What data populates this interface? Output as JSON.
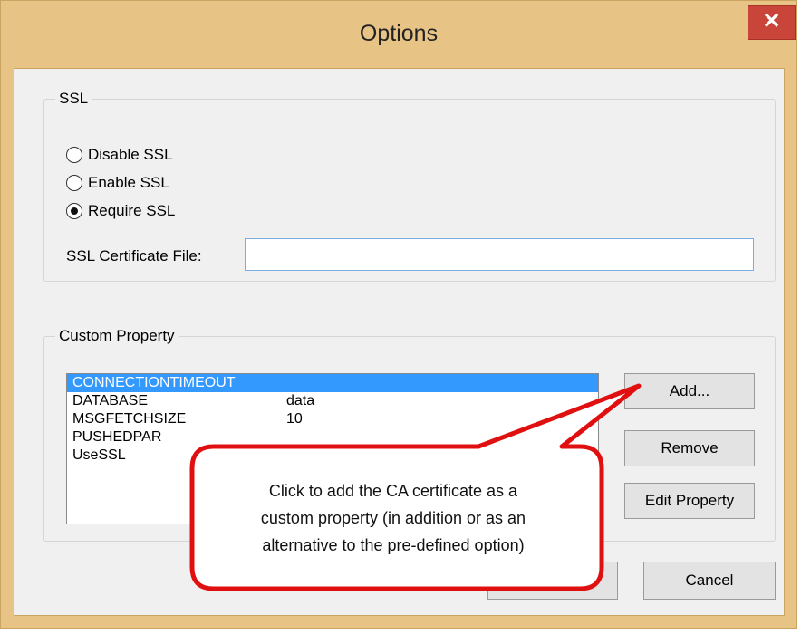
{
  "window": {
    "title": "Options",
    "close_glyph": "✕"
  },
  "ssl": {
    "group_title": "SSL",
    "options": [
      {
        "label": "Disable SSL",
        "checked": false
      },
      {
        "label": "Enable SSL",
        "checked": false
      },
      {
        "label": "Require SSL",
        "checked": true
      }
    ],
    "certificate_label": "SSL Certificate File:",
    "certificate_value": ""
  },
  "custom_property": {
    "group_title": "Custom Property",
    "items": [
      {
        "name": "CONNECTIONTIMEOUT",
        "value": "",
        "selected": true
      },
      {
        "name": "DATABASE",
        "value": "data",
        "selected": false
      },
      {
        "name": "MSGFETCHSIZE",
        "value": "10",
        "selected": false
      },
      {
        "name": "PUSHEDPAR",
        "value": "",
        "selected": false
      },
      {
        "name": "UseSSL",
        "value": "",
        "selected": false
      }
    ],
    "add_label": "Add...",
    "remove_label": "Remove",
    "edit_label": "Edit Property"
  },
  "footer": {
    "cancel_label": "Cancel"
  },
  "callout": {
    "line1": "Click to add the CA certificate as a",
    "line2": "custom property (in addition or as an",
    "line3": "alternative to the pre-defined option)"
  },
  "colors": {
    "frame": "#e8c386",
    "close": "#c9453a",
    "selection": "#3399ff",
    "callout_border": "#e01010"
  },
  "icons": {
    "close": "close-icon"
  }
}
